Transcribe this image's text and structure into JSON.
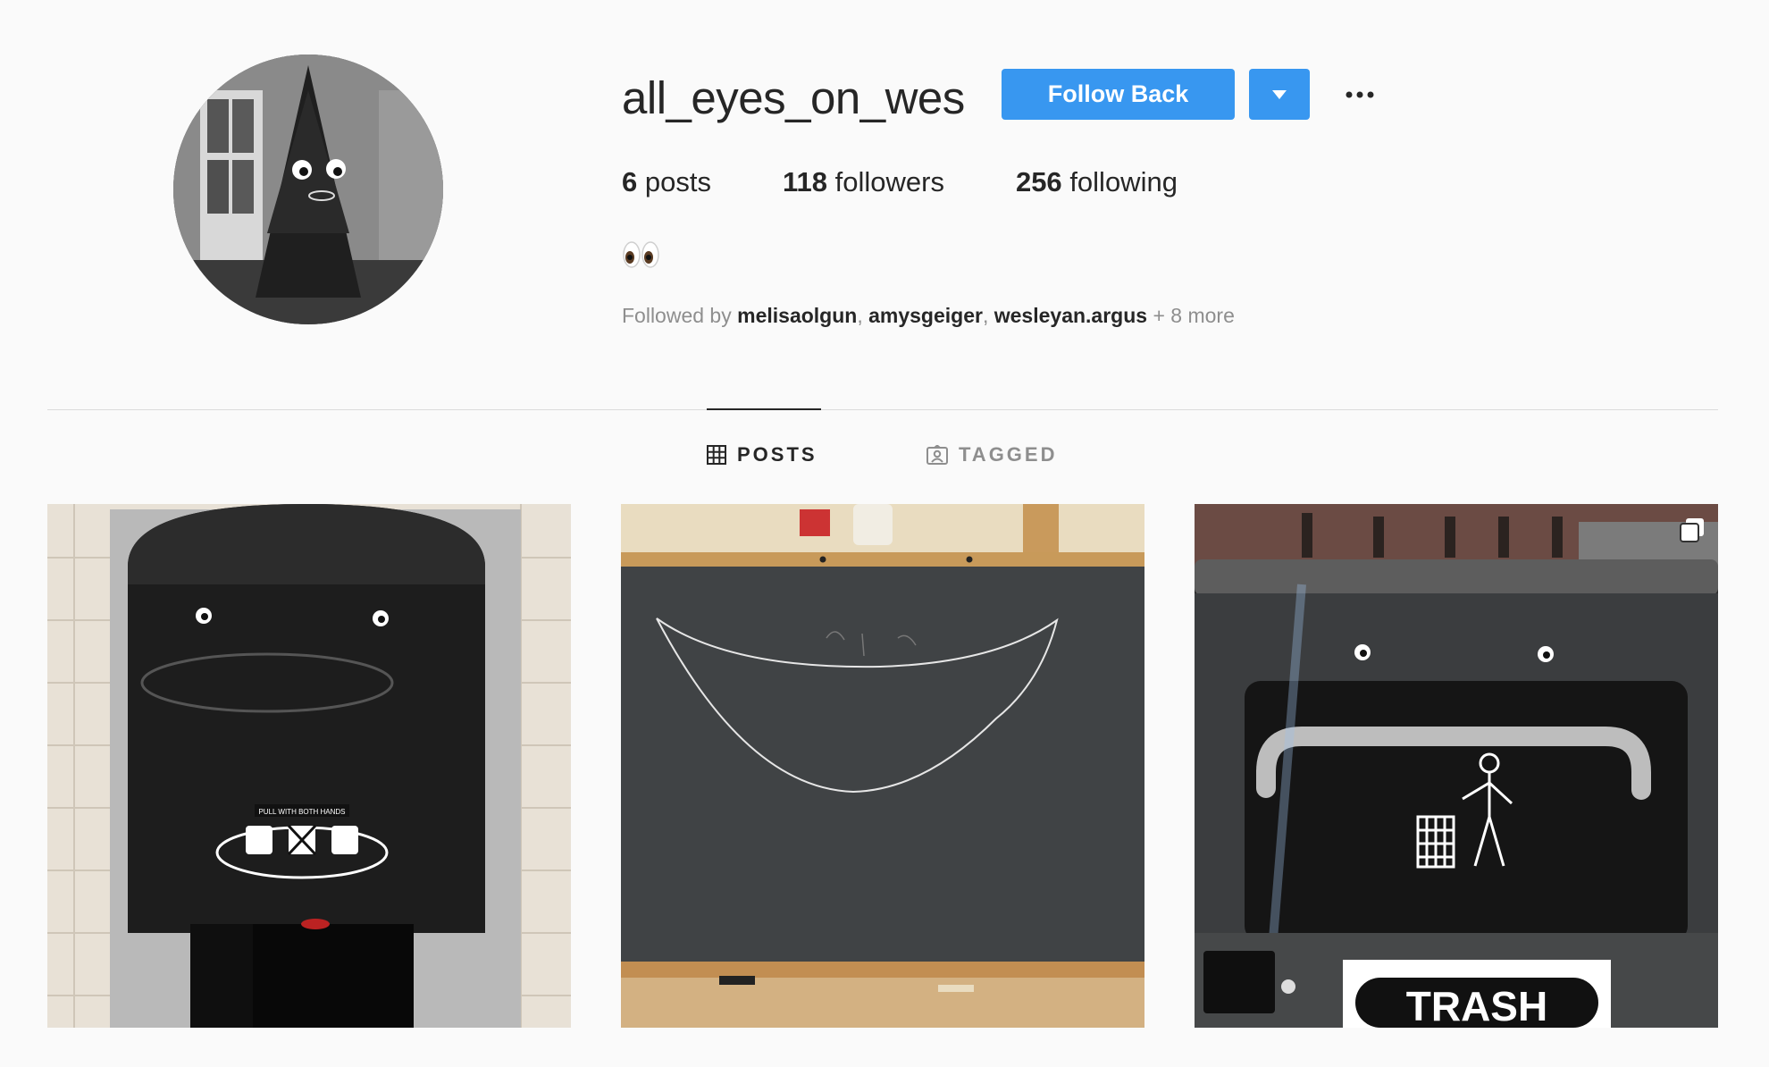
{
  "profile": {
    "username": "all_eyes_on_wes",
    "follow_label": "Follow Back",
    "avatar_icon": "avatar-tree-googly-eyes",
    "stats": {
      "posts_count": "6",
      "posts_label": "posts",
      "followers_count": "118",
      "followers_label": "followers",
      "following_count": "256",
      "following_label": "following"
    },
    "bio": "👀",
    "followed_by": {
      "prefix": "Followed by",
      "names": [
        "melisaolgun",
        "amysgeiger",
        "wesleyan.argus"
      ],
      "more": "+ 8 more"
    }
  },
  "tabs": [
    {
      "label": "POSTS",
      "icon": "grid-icon",
      "active": true
    },
    {
      "label": "TAGGED",
      "icon": "tagged-icon",
      "active": false
    }
  ],
  "posts": [
    {
      "subject": "paper towel dispenser with googly eyes",
      "sticker_text": "PULL WITH BOTH HANDS"
    },
    {
      "subject": "chalkboard with drawn smile"
    },
    {
      "subject": "trash bin with googly eyes",
      "label_text": "TRASH",
      "multi": true
    }
  ],
  "colors": {
    "accent": "#3897f0",
    "text": "#262626",
    "muted": "#8e8e8e",
    "background": "#fafafa"
  }
}
